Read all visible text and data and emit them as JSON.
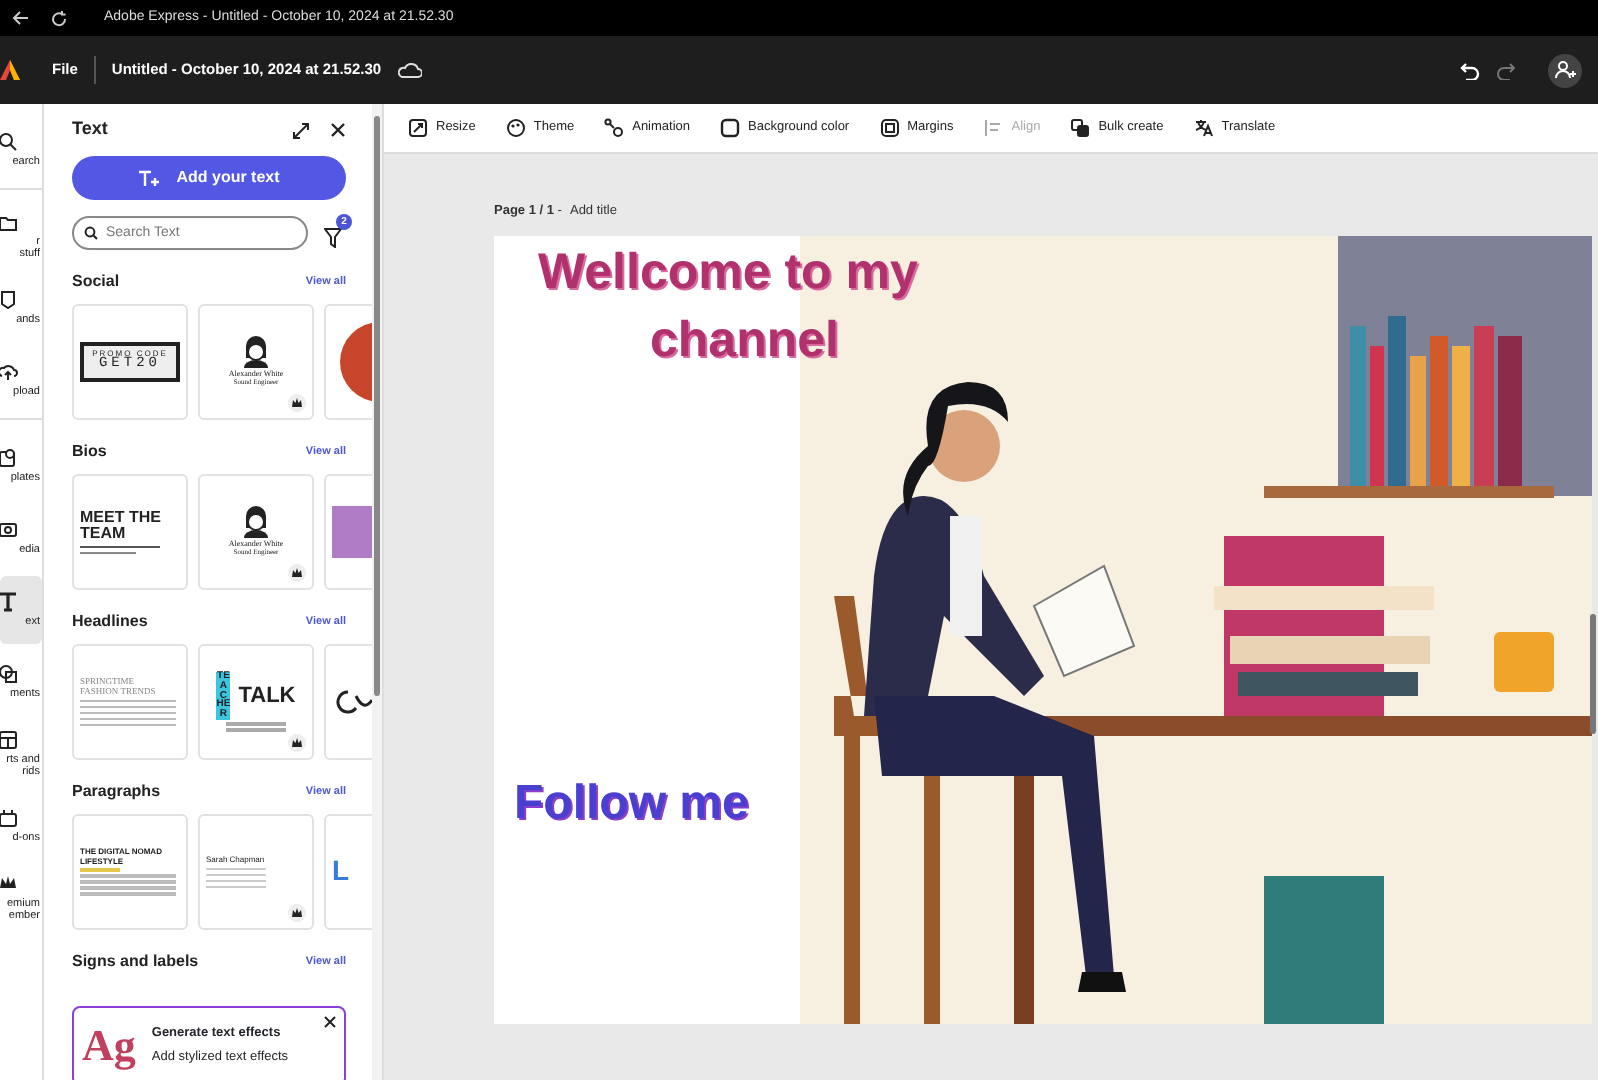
{
  "window": {
    "title": "Adobe Express - Untitled - October 10, 2024 at 21.52.30"
  },
  "app_bar": {
    "menu": "File",
    "document_title": "Untitled - October 10, 2024 at 21.52.30"
  },
  "rail": [
    {
      "label": "earch",
      "selected": false
    },
    {
      "label": "r stuff",
      "selected": false
    },
    {
      "label": "ands",
      "selected": false
    },
    {
      "label": "pload",
      "selected": false
    },
    {
      "label": "plates",
      "selected": false
    },
    {
      "label": "edia",
      "selected": false
    },
    {
      "label": "ext",
      "selected": true
    },
    {
      "label": "ments",
      "selected": false
    },
    {
      "label": "rts and rids",
      "selected": false
    },
    {
      "label": "d-ons",
      "selected": false
    },
    {
      "label": "emium ember",
      "selected": false
    }
  ],
  "panel": {
    "title": "Text",
    "add_button": "Add your text",
    "search": {
      "placeholder": "Search Text"
    },
    "filter_count": "2",
    "sections": [
      {
        "title": "Social",
        "link": "View all",
        "templates": [
          {
            "kind": "promo",
            "lines": [
              "PROMO CODE",
              "GET20"
            ],
            "premium": false
          },
          {
            "kind": "bio",
            "lines": [
              "Alexander White",
              "Sound Engineer"
            ],
            "premium": true
          },
          {
            "kind": "circle"
          }
        ]
      },
      {
        "title": "Bios",
        "link": "View all",
        "templates": [
          {
            "kind": "team",
            "lines": [
              "MEET THE",
              "TEAM"
            ],
            "premium": false
          },
          {
            "kind": "bio",
            "lines": [
              "Alexander White",
              "Sound Engineer"
            ],
            "premium": true
          },
          {
            "kind": "purple"
          }
        ]
      },
      {
        "title": "Headlines",
        "link": "View all",
        "templates": [
          {
            "kind": "serif",
            "lines": [
              "SPRINGTIME",
              "FASHION TRENDS"
            ],
            "premium": false
          },
          {
            "kind": "vertical",
            "lines": [
              "TEACHER",
              "TALK"
            ],
            "premium": true
          },
          {
            "kind": "script"
          }
        ]
      },
      {
        "title": "Paragraphs",
        "link": "View all",
        "templates": [
          {
            "kind": "article",
            "lines": [
              "THE DIGITAL NOMAD LIFESTYLE"
            ],
            "premium": false
          },
          {
            "kind": "letter",
            "lines": [
              "Sarah Chapman"
            ],
            "premium": true
          },
          {
            "kind": "bigletter",
            "lines": [
              "L"
            ]
          }
        ]
      },
      {
        "title": "Signs and labels",
        "link": "View all"
      }
    ],
    "promo": {
      "sample": "Ag",
      "title": "Generate text effects",
      "subtitle": "Add stylized text effects"
    }
  },
  "toolbar": [
    {
      "label": "Resize",
      "disabled": false
    },
    {
      "label": "Theme",
      "disabled": false
    },
    {
      "label": "Animation",
      "disabled": false
    },
    {
      "label": "Background color",
      "disabled": false
    },
    {
      "label": "Margins",
      "disabled": false
    },
    {
      "label": "Align",
      "disabled": true
    },
    {
      "label": "Bulk create",
      "disabled": false
    },
    {
      "label": "Translate",
      "disabled": false
    }
  ],
  "page": {
    "label": "Page 1 / 1",
    "separator": "-",
    "action": "Add title",
    "texts": [
      {
        "text": "Wellcome to my",
        "kind": "glitter"
      },
      {
        "text": "channel",
        "kind": "glitter"
      },
      {
        "text": "Follow me",
        "kind": "gradient"
      }
    ]
  }
}
